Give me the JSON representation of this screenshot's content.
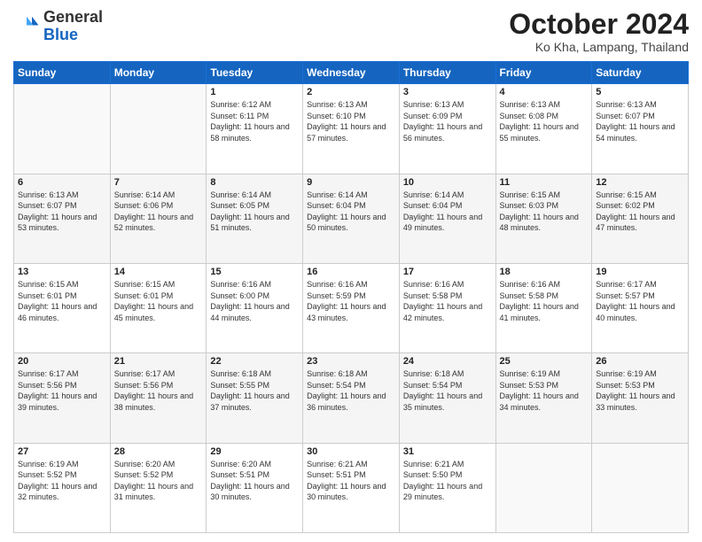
{
  "header": {
    "logo_general": "General",
    "logo_blue": "Blue",
    "month_title": "October 2024",
    "location": "Ko Kha, Lampang, Thailand"
  },
  "days_of_week": [
    "Sunday",
    "Monday",
    "Tuesday",
    "Wednesday",
    "Thursday",
    "Friday",
    "Saturday"
  ],
  "weeks": [
    [
      {
        "day": "",
        "info": ""
      },
      {
        "day": "",
        "info": ""
      },
      {
        "day": "1",
        "info": "Sunrise: 6:12 AM\nSunset: 6:11 PM\nDaylight: 11 hours and 58 minutes."
      },
      {
        "day": "2",
        "info": "Sunrise: 6:13 AM\nSunset: 6:10 PM\nDaylight: 11 hours and 57 minutes."
      },
      {
        "day": "3",
        "info": "Sunrise: 6:13 AM\nSunset: 6:09 PM\nDaylight: 11 hours and 56 minutes."
      },
      {
        "day": "4",
        "info": "Sunrise: 6:13 AM\nSunset: 6:08 PM\nDaylight: 11 hours and 55 minutes."
      },
      {
        "day": "5",
        "info": "Sunrise: 6:13 AM\nSunset: 6:07 PM\nDaylight: 11 hours and 54 minutes."
      }
    ],
    [
      {
        "day": "6",
        "info": "Sunrise: 6:13 AM\nSunset: 6:07 PM\nDaylight: 11 hours and 53 minutes."
      },
      {
        "day": "7",
        "info": "Sunrise: 6:14 AM\nSunset: 6:06 PM\nDaylight: 11 hours and 52 minutes."
      },
      {
        "day": "8",
        "info": "Sunrise: 6:14 AM\nSunset: 6:05 PM\nDaylight: 11 hours and 51 minutes."
      },
      {
        "day": "9",
        "info": "Sunrise: 6:14 AM\nSunset: 6:04 PM\nDaylight: 11 hours and 50 minutes."
      },
      {
        "day": "10",
        "info": "Sunrise: 6:14 AM\nSunset: 6:04 PM\nDaylight: 11 hours and 49 minutes."
      },
      {
        "day": "11",
        "info": "Sunrise: 6:15 AM\nSunset: 6:03 PM\nDaylight: 11 hours and 48 minutes."
      },
      {
        "day": "12",
        "info": "Sunrise: 6:15 AM\nSunset: 6:02 PM\nDaylight: 11 hours and 47 minutes."
      }
    ],
    [
      {
        "day": "13",
        "info": "Sunrise: 6:15 AM\nSunset: 6:01 PM\nDaylight: 11 hours and 46 minutes."
      },
      {
        "day": "14",
        "info": "Sunrise: 6:15 AM\nSunset: 6:01 PM\nDaylight: 11 hours and 45 minutes."
      },
      {
        "day": "15",
        "info": "Sunrise: 6:16 AM\nSunset: 6:00 PM\nDaylight: 11 hours and 44 minutes."
      },
      {
        "day": "16",
        "info": "Sunrise: 6:16 AM\nSunset: 5:59 PM\nDaylight: 11 hours and 43 minutes."
      },
      {
        "day": "17",
        "info": "Sunrise: 6:16 AM\nSunset: 5:58 PM\nDaylight: 11 hours and 42 minutes."
      },
      {
        "day": "18",
        "info": "Sunrise: 6:16 AM\nSunset: 5:58 PM\nDaylight: 11 hours and 41 minutes."
      },
      {
        "day": "19",
        "info": "Sunrise: 6:17 AM\nSunset: 5:57 PM\nDaylight: 11 hours and 40 minutes."
      }
    ],
    [
      {
        "day": "20",
        "info": "Sunrise: 6:17 AM\nSunset: 5:56 PM\nDaylight: 11 hours and 39 minutes."
      },
      {
        "day": "21",
        "info": "Sunrise: 6:17 AM\nSunset: 5:56 PM\nDaylight: 11 hours and 38 minutes."
      },
      {
        "day": "22",
        "info": "Sunrise: 6:18 AM\nSunset: 5:55 PM\nDaylight: 11 hours and 37 minutes."
      },
      {
        "day": "23",
        "info": "Sunrise: 6:18 AM\nSunset: 5:54 PM\nDaylight: 11 hours and 36 minutes."
      },
      {
        "day": "24",
        "info": "Sunrise: 6:18 AM\nSunset: 5:54 PM\nDaylight: 11 hours and 35 minutes."
      },
      {
        "day": "25",
        "info": "Sunrise: 6:19 AM\nSunset: 5:53 PM\nDaylight: 11 hours and 34 minutes."
      },
      {
        "day": "26",
        "info": "Sunrise: 6:19 AM\nSunset: 5:53 PM\nDaylight: 11 hours and 33 minutes."
      }
    ],
    [
      {
        "day": "27",
        "info": "Sunrise: 6:19 AM\nSunset: 5:52 PM\nDaylight: 11 hours and 32 minutes."
      },
      {
        "day": "28",
        "info": "Sunrise: 6:20 AM\nSunset: 5:52 PM\nDaylight: 11 hours and 31 minutes."
      },
      {
        "day": "29",
        "info": "Sunrise: 6:20 AM\nSunset: 5:51 PM\nDaylight: 11 hours and 30 minutes."
      },
      {
        "day": "30",
        "info": "Sunrise: 6:21 AM\nSunset: 5:51 PM\nDaylight: 11 hours and 30 minutes."
      },
      {
        "day": "31",
        "info": "Sunrise: 6:21 AM\nSunset: 5:50 PM\nDaylight: 11 hours and 29 minutes."
      },
      {
        "day": "",
        "info": ""
      },
      {
        "day": "",
        "info": ""
      }
    ]
  ]
}
